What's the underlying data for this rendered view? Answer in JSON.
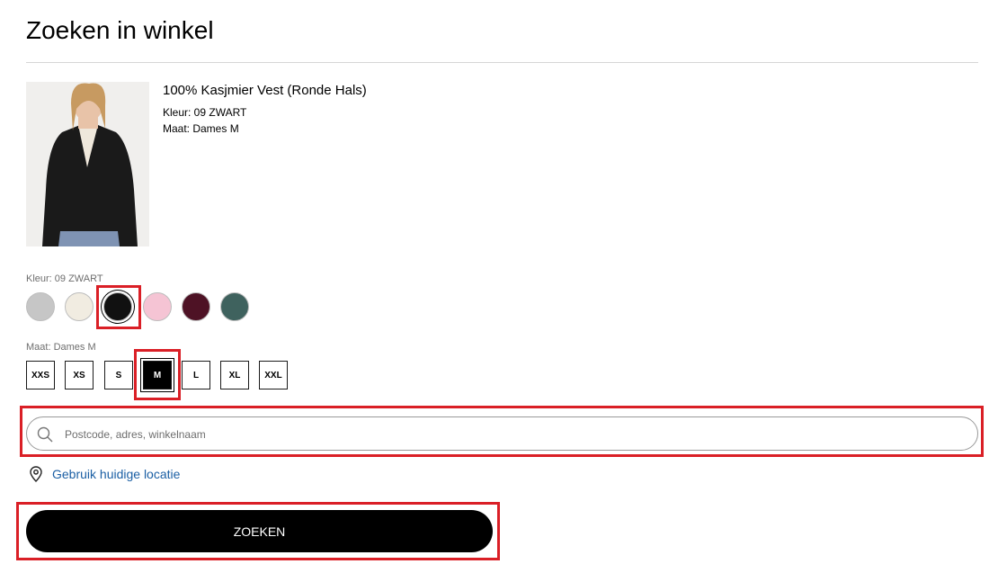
{
  "page": {
    "title": "Zoeken in winkel"
  },
  "product": {
    "name": "100% Kasjmier Vest (Ronde Hals)",
    "color_line": "Kleur: 09 ZWART",
    "size_line": "Maat: Dames M"
  },
  "color_picker": {
    "label": "Kleur: 09 ZWART",
    "swatches": [
      {
        "color": "#c6c6c6",
        "selected": false
      },
      {
        "color": "#f1ece1",
        "selected": false
      },
      {
        "color": "#111111",
        "selected": true
      },
      {
        "color": "#f5c4d4",
        "selected": false
      },
      {
        "color": "#4e1225",
        "selected": false
      },
      {
        "color": "#3f625e",
        "selected": false
      }
    ]
  },
  "size_picker": {
    "label": "Maat: Dames M",
    "sizes": [
      {
        "label": "XXS",
        "selected": false
      },
      {
        "label": "XS",
        "selected": false
      },
      {
        "label": "S",
        "selected": false
      },
      {
        "label": "M",
        "selected": true
      },
      {
        "label": "L",
        "selected": false
      },
      {
        "label": "XL",
        "selected": false
      },
      {
        "label": "XXL",
        "selected": false
      }
    ]
  },
  "search": {
    "placeholder": "Postcode, adres, winkelnaam",
    "value": ""
  },
  "location": {
    "label": "Gebruik huidige locatie"
  },
  "submit": {
    "label": "ZOEKEN"
  },
  "colors": {
    "highlight": "#da1f26",
    "link": "#1b5fa4",
    "button_bg": "#000000"
  },
  "icons": {
    "search": "search-icon",
    "location": "location-pin-icon"
  }
}
